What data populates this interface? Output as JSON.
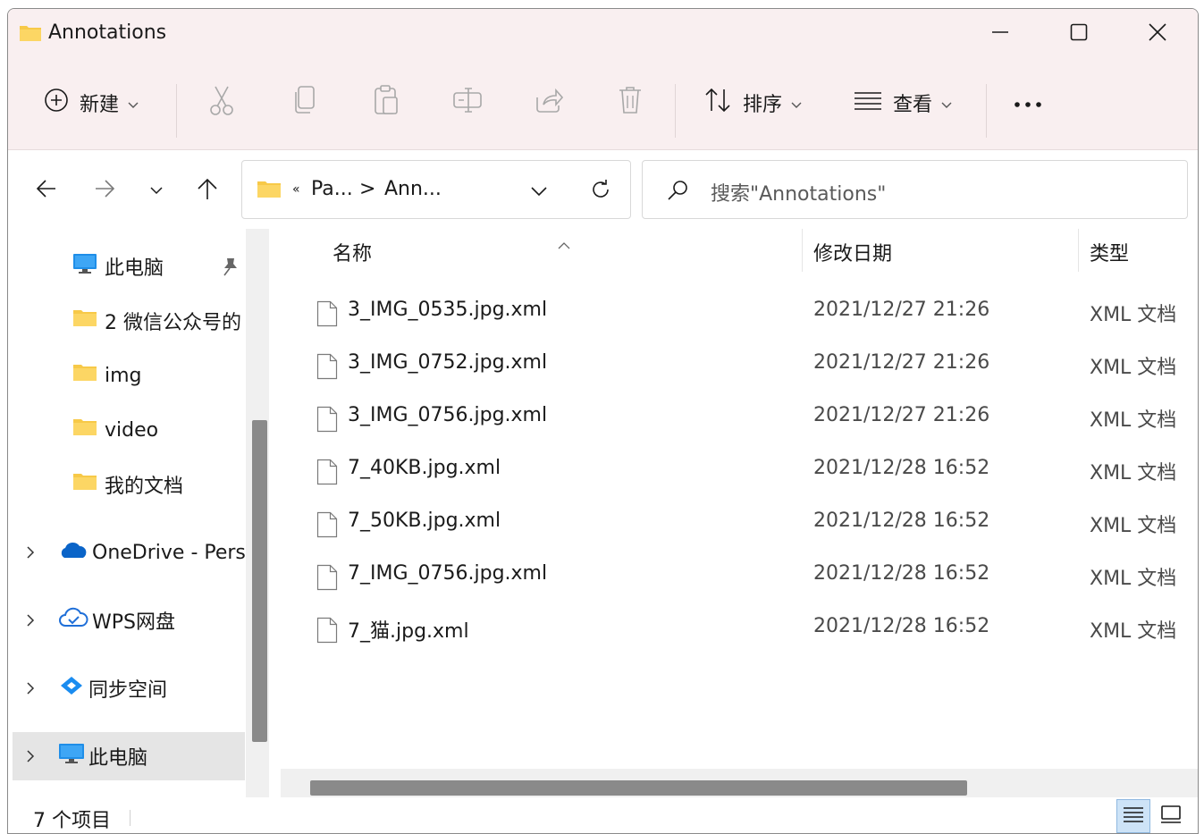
{
  "window": {
    "title": "Annotations"
  },
  "title_icon": "folder-icon",
  "window_controls": [
    "minimize-icon",
    "maximize-icon",
    "close-icon"
  ],
  "toolbar": {
    "new_label": "新建",
    "sort_label": "排序",
    "view_label": "查看",
    "icons": [
      "add-circle-icon",
      "cut-icon",
      "copy-icon",
      "paste-icon",
      "rename-icon",
      "share-icon",
      "delete-icon",
      "sort-icon",
      "view-list-icon",
      "more-icon"
    ]
  },
  "address": {
    "crumbs": [
      "Pa...",
      "Ann..."
    ],
    "overflow": "«",
    "separator": ">"
  },
  "search": {
    "placeholder": "搜索\"Annotations\""
  },
  "nav": {
    "items": [
      {
        "label": "此电脑",
        "icon": "monitor-icon",
        "pinned": true
      },
      {
        "label": "2 微信公众号的",
        "icon": "folder-icon"
      },
      {
        "label": "img",
        "icon": "folder-icon"
      },
      {
        "label": "video",
        "icon": "folder-icon"
      },
      {
        "label": "我的文档",
        "icon": "folder-icon"
      },
      {
        "label": "OneDrive - Pers",
        "icon": "onedrive-cloud-icon",
        "expandable": true
      },
      {
        "label": "WPS网盘",
        "icon": "wps-cloud-icon",
        "expandable": true
      },
      {
        "label": "同步空间",
        "icon": "sync-space-icon",
        "expandable": true
      },
      {
        "label": "此电脑",
        "icon": "monitor-icon",
        "expandable": true,
        "selected": true
      }
    ]
  },
  "table": {
    "columns": [
      "名称",
      "修改日期",
      "类型"
    ],
    "rows": [
      {
        "name": "3_IMG_0535.jpg.xml",
        "date": "2021/12/27 21:26",
        "type": "XML 文档"
      },
      {
        "name": "3_IMG_0752.jpg.xml",
        "date": "2021/12/27 21:26",
        "type": "XML 文档"
      },
      {
        "name": "3_IMG_0756.jpg.xml",
        "date": "2021/12/27 21:26",
        "type": "XML 文档"
      },
      {
        "name": "7_40KB.jpg.xml",
        "date": "2021/12/28 16:52",
        "type": "XML 文档"
      },
      {
        "name": "7_50KB.jpg.xml",
        "date": "2021/12/28 16:52",
        "type": "XML 文档"
      },
      {
        "name": "7_IMG_0756.jpg.xml",
        "date": "2021/12/28 16:52",
        "type": "XML 文档"
      },
      {
        "name": "7_猫.jpg.xml",
        "date": "2021/12/28 16:52",
        "type": "XML 文档"
      }
    ]
  },
  "status": {
    "count_text": "7 个项目"
  },
  "colors": {
    "titlebar": "#f9eff0",
    "folder": "#f7c948",
    "accent": "#0067c0",
    "selected": "#e5e5e5"
  }
}
